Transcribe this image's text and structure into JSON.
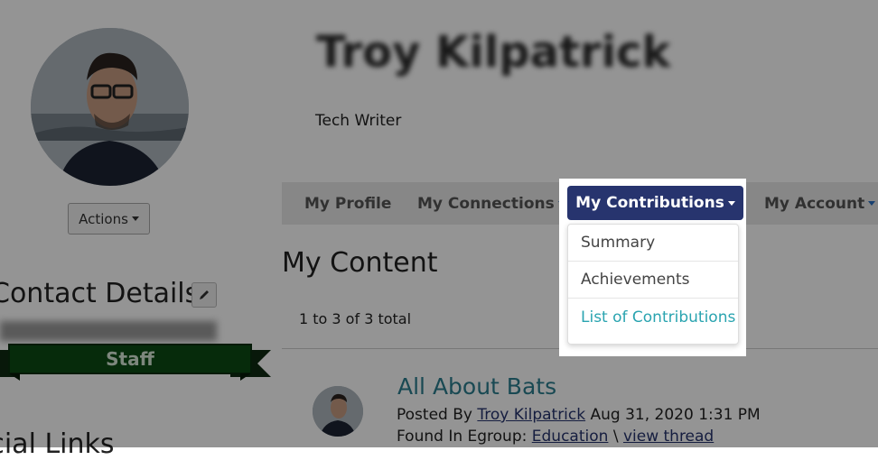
{
  "profile": {
    "name": "Troy Kilpatrick",
    "job_title": "Tech Writer",
    "actions_label": "Actions"
  },
  "sidebar": {
    "contact_heading": "Contact Details",
    "staff_badge": "Staff",
    "social_heading": "ocial Links"
  },
  "nav": {
    "items": [
      {
        "label": "My Profile"
      },
      {
        "label": "My Connections"
      },
      {
        "label": "My Contributions"
      },
      {
        "label": "My Account"
      }
    ],
    "active_color": "#27346e"
  },
  "dropdown": {
    "items": [
      {
        "label": "Summary"
      },
      {
        "label": "Achievements"
      },
      {
        "label": "List of Contributions"
      }
    ]
  },
  "content": {
    "heading": "My Content",
    "count": "1 to 3 of 3 total",
    "post": {
      "title": "All About Bats",
      "posted_by_prefix": "Posted By",
      "author": "Troy Kilpatrick",
      "date": "Aug 31, 2020 1:31 PM",
      "found_prefix": "Found In Egroup:",
      "group": "Education",
      "separator": "\\",
      "thread_link": "view thread"
    }
  }
}
